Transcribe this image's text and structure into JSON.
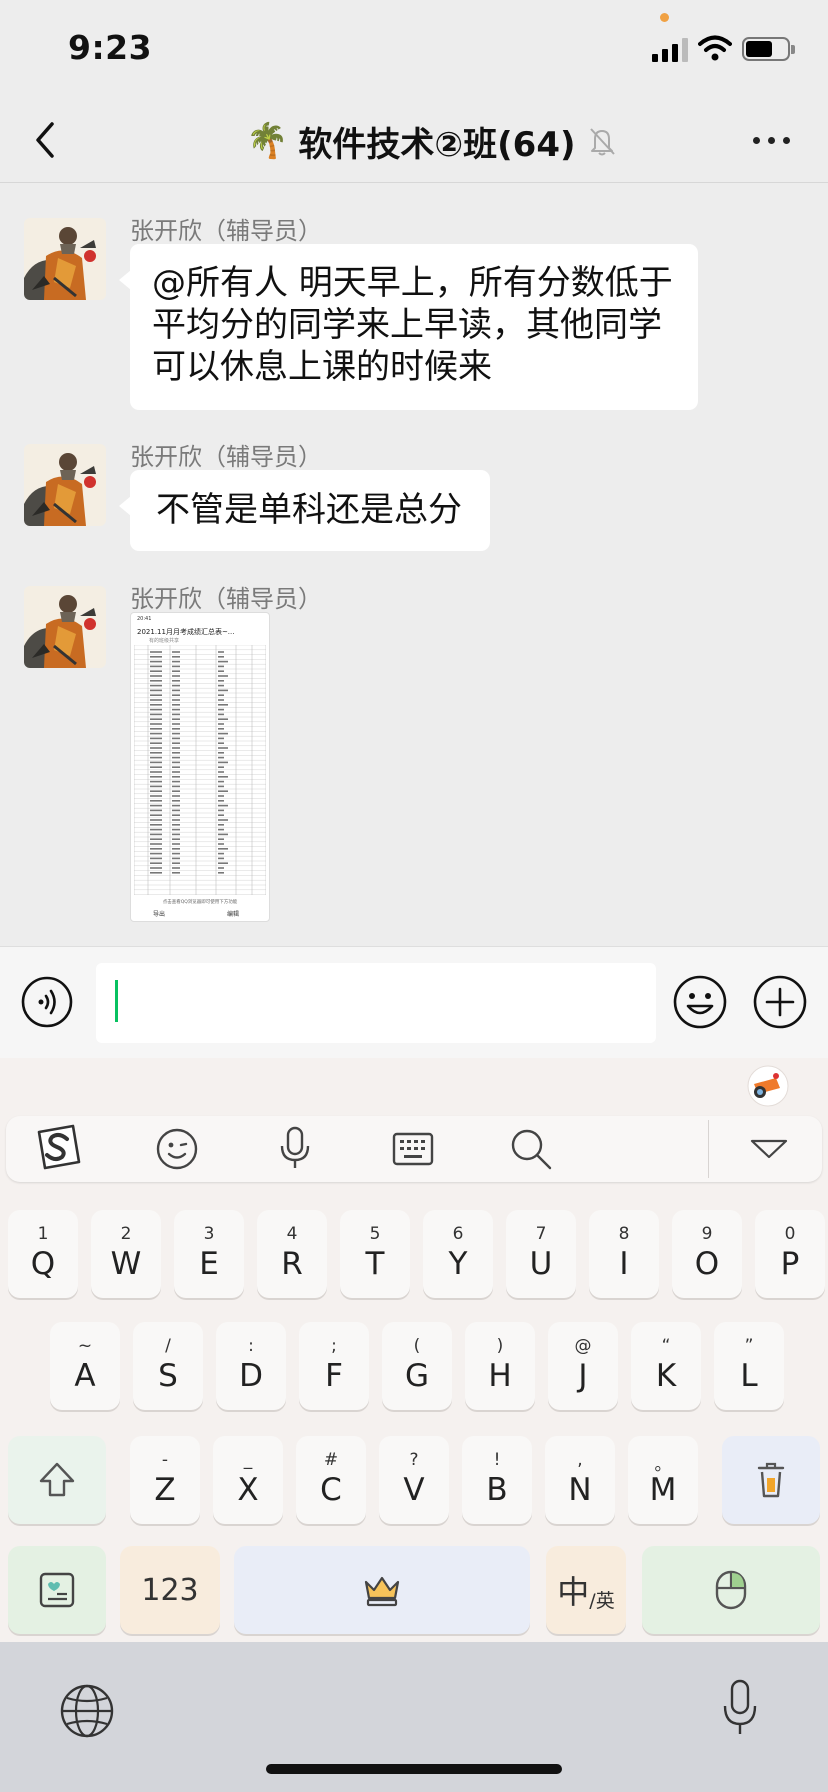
{
  "status_bar": {
    "time": "9:23"
  },
  "nav": {
    "title": "软件技术②班(64)",
    "title_icon": "palm-tree-icon",
    "back_icon": "chevron-left-icon",
    "more_icon": "more-dots-icon",
    "mute_icon": "bell-off-icon"
  },
  "messages": [
    {
      "sender": "张开欣（辅导员）",
      "type": "text",
      "text": "@所有人 明天早上，所有分数低于平均分的同学来上早读，其他同学可以休息上课的时候来"
    },
    {
      "sender": "张开欣（辅导员）",
      "type": "text",
      "text": "不管是单科还是总分"
    },
    {
      "sender": "张开欣（辅导员）",
      "type": "image",
      "image": {
        "time": "20:41",
        "title": "2021.11月月考成绩汇总表~...",
        "subtitle": "有的班级共享",
        "footer_note": "点击查看QQ浏览器即可使用下方功能",
        "export_label": "导出",
        "edit_label": "编辑"
      }
    }
  ],
  "input": {
    "value": "",
    "placeholder": ""
  },
  "keyboard": {
    "toolbar": [
      "sogou-logo-icon",
      "emoji-face-icon",
      "microphone-icon",
      "keyboard-layout-icon",
      "search-icon",
      "collapse-keyboard-icon"
    ],
    "rows": [
      [
        {
          "main": "Q",
          "sub": "1"
        },
        {
          "main": "W",
          "sub": "2"
        },
        {
          "main": "E",
          "sub": "3"
        },
        {
          "main": "R",
          "sub": "4"
        },
        {
          "main": "T",
          "sub": "5"
        },
        {
          "main": "Y",
          "sub": "6"
        },
        {
          "main": "U",
          "sub": "7"
        },
        {
          "main": "I",
          "sub": "8"
        },
        {
          "main": "O",
          "sub": "9"
        },
        {
          "main": "P",
          "sub": "0"
        }
      ],
      [
        {
          "main": "A",
          "sub": "~"
        },
        {
          "main": "S",
          "sub": "/"
        },
        {
          "main": "D",
          "sub": ":"
        },
        {
          "main": "F",
          "sub": ";"
        },
        {
          "main": "G",
          "sub": "("
        },
        {
          "main": "H",
          "sub": ")"
        },
        {
          "main": "J",
          "sub": "@"
        },
        {
          "main": "K",
          "sub": "“"
        },
        {
          "main": "L",
          "sub": "”"
        }
      ],
      [
        {
          "main": "Z",
          "sub": "-"
        },
        {
          "main": "X",
          "sub": "_"
        },
        {
          "main": "C",
          "sub": "#"
        },
        {
          "main": "V",
          "sub": "?"
        },
        {
          "main": "B",
          "sub": "!"
        },
        {
          "main": "N",
          "sub": ","
        },
        {
          "main": "M",
          "sub": "。"
        }
      ]
    ],
    "num_key": "123",
    "lang_key_main": "中",
    "lang_key_sub": "/英",
    "colors": {
      "shift": "#eaf3ec",
      "delete": "#e9edf7",
      "num": "#f8ecdd",
      "space": "#e9edf7",
      "lang": "#f8ecdd",
      "enter": "#e4f1e3"
    }
  }
}
